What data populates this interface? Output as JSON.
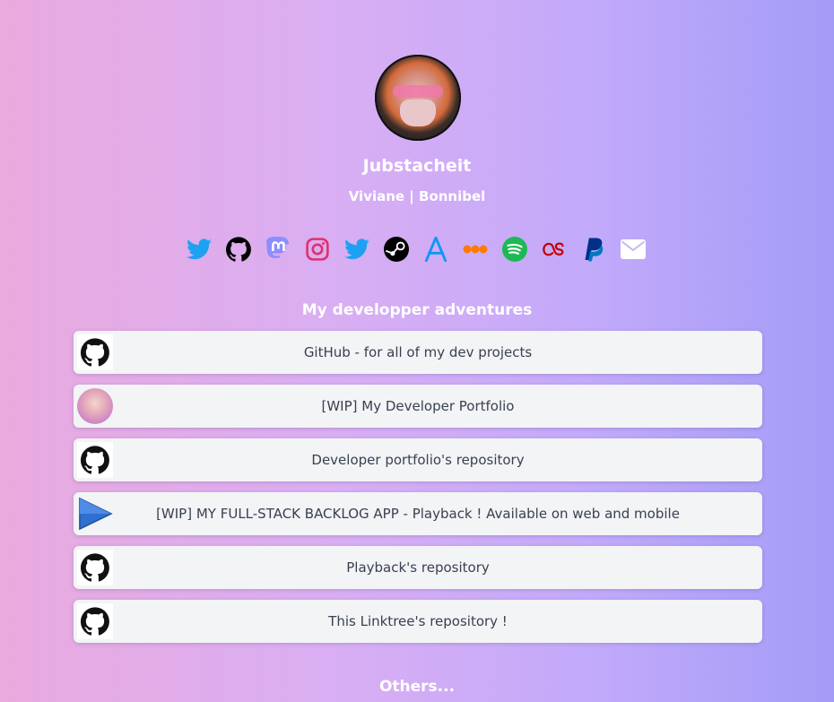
{
  "profile": {
    "name": "Jubstacheit",
    "bio": "Viviane | Bonnibel"
  },
  "socials": [
    {
      "icon": "twitter-icon",
      "color": "#1da1f2"
    },
    {
      "icon": "github-icon",
      "color": "#000000"
    },
    {
      "icon": "mastodon-icon",
      "color": "#8c8dff"
    },
    {
      "icon": "instagram-icon",
      "color": "#e1306c"
    },
    {
      "icon": "twitter-icon",
      "color": "#1da1f2"
    },
    {
      "icon": "steam-icon",
      "color": "#000000"
    },
    {
      "icon": "app-store-icon",
      "color": "#0d96f6"
    },
    {
      "icon": "flickr-icon",
      "color": "#ff7a00"
    },
    {
      "icon": "spotify-icon",
      "color": "#1db954"
    },
    {
      "icon": "lastfm-icon",
      "color": "#c30000"
    },
    {
      "icon": "paypal-icon",
      "color": "#003087"
    },
    {
      "icon": "email-icon",
      "color": "#ffffff"
    }
  ],
  "sections": [
    {
      "title": "My developper adventures",
      "links": [
        {
          "label": "GitHub - for all of my dev projects",
          "thumb": "github-icon"
        },
        {
          "label": "[WIP] My Developer Portfolio",
          "thumb": "profile-photo"
        },
        {
          "label": "Developer portfolio's repository",
          "thumb": "github-icon"
        },
        {
          "label": "[WIP] MY FULL-STACK BACKLOG APP - Playback ! Available on web and mobile",
          "thumb": "play-icon"
        },
        {
          "label": "Playback's repository",
          "thumb": "github-icon"
        },
        {
          "label": "This Linktree's repository !",
          "thumb": "github-icon"
        }
      ]
    },
    {
      "title": "Others..."
    }
  ]
}
